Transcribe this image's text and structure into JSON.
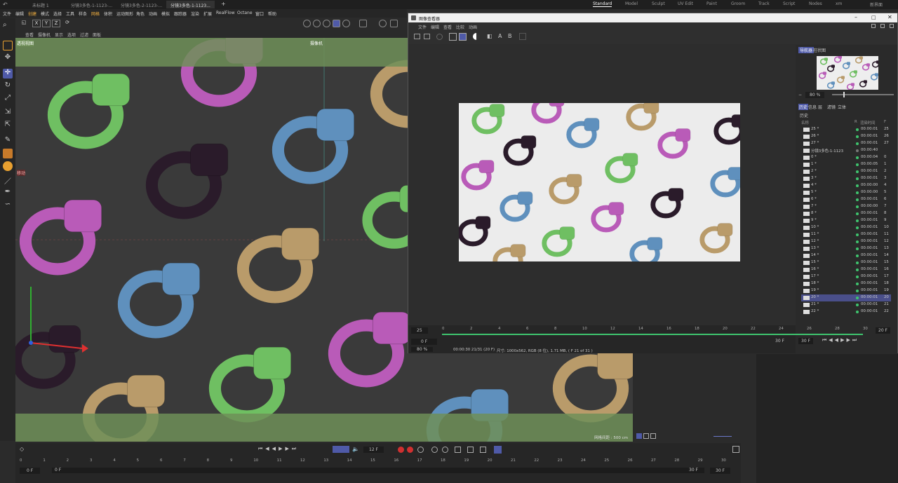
{
  "tabs": {
    "documents": [
      "未标题 1",
      "分镜3多色-1-1123-...",
      "分镜3多色-2-1123-...",
      "分镜3多色-1-1123..."
    ],
    "layouts": [
      "Standard",
      "Model",
      "Sculpt",
      "UV Edit",
      "Paint",
      "Groom",
      "Track",
      "Script",
      "Nodes",
      "xm",
      "新界面"
    ],
    "active_layout": "Standard"
  },
  "menu": [
    "文件",
    "编辑",
    "创建",
    "模式",
    "选择",
    "工具",
    "样条",
    "网格",
    "体积",
    "运动图形",
    "角色",
    "动画",
    "模拟",
    "跟踪器",
    "渲染",
    "扩展",
    "RealFlow",
    "Octane",
    "窗口",
    "帮助"
  ],
  "axes": [
    "X",
    "Y",
    "Z"
  ],
  "viewport": {
    "menu": [
      "查看",
      "摄像机",
      "显示",
      "选项",
      "过滤",
      "面板"
    ],
    "label": "透视视图",
    "camera_label": "摄像机",
    "move_label": "移动",
    "grid_label": "网格间距 : 500 cm"
  },
  "viewer": {
    "title": "图像查看器",
    "menu": [
      "文件",
      "编辑",
      "查看",
      "比较",
      "动画"
    ],
    "nav_tabs": [
      "导航器",
      "柱状图"
    ],
    "zoom": "80 %",
    "hist_tabs": [
      "历史",
      "信息",
      "层",
      "滤镜",
      "立体"
    ],
    "hist_header": "历史",
    "cols": {
      "name": "名称",
      "r": "R",
      "time": "渲染时间",
      "f": "F"
    },
    "rows": [
      {
        "label": "25 *",
        "time": "00:00:01",
        "f": "25"
      },
      {
        "label": "26 *",
        "time": "00:00:01",
        "f": "26"
      },
      {
        "label": "27 *",
        "time": "00:00:01",
        "f": "27"
      },
      {
        "label": "分镜3多色-1-1123",
        "time": "00:00:40",
        "f": ""
      },
      {
        "label": "0 *",
        "time": "00:00:04",
        "f": "0"
      },
      {
        "label": "1 *",
        "time": "00:00:05",
        "f": "1"
      },
      {
        "label": "2 *",
        "time": "00:00:01",
        "f": "2"
      },
      {
        "label": "3 *",
        "time": "00:00:01",
        "f": "3"
      },
      {
        "label": "4 *",
        "time": "00:00:00",
        "f": "4"
      },
      {
        "label": "5 *",
        "time": "00:00:00",
        "f": "5"
      },
      {
        "label": "6 *",
        "time": "00:00:01",
        "f": "6"
      },
      {
        "label": "7 *",
        "time": "00:00:00",
        "f": "7"
      },
      {
        "label": "8 *",
        "time": "00:00:01",
        "f": "8"
      },
      {
        "label": "9 *",
        "time": "00:00:01",
        "f": "9"
      },
      {
        "label": "10 *",
        "time": "00:00:01",
        "f": "10"
      },
      {
        "label": "11 *",
        "time": "00:00:01",
        "f": "11"
      },
      {
        "label": "12 *",
        "time": "00:00:01",
        "f": "12"
      },
      {
        "label": "13 *",
        "time": "00:00:01",
        "f": "13"
      },
      {
        "label": "14 *",
        "time": "00:00:01",
        "f": "14"
      },
      {
        "label": "15 *",
        "time": "00:00:01",
        "f": "15"
      },
      {
        "label": "16 *",
        "time": "00:00:01",
        "f": "16"
      },
      {
        "label": "17 *",
        "time": "00:00:01",
        "f": "17"
      },
      {
        "label": "18 *",
        "time": "00:00:01",
        "f": "18"
      },
      {
        "label": "19 *",
        "time": "00:00:01",
        "f": "19"
      },
      {
        "label": "20 *",
        "time": "00:00:01",
        "f": "20"
      },
      {
        "label": "21 *",
        "time": "00:00:01",
        "f": "21"
      },
      {
        "label": "22 *",
        "time": "00:00:01",
        "f": "22"
      }
    ],
    "selected_row": 24,
    "timeline": {
      "start": "25",
      "end_field": "20 F",
      "frame": "0 F",
      "end": "30 F",
      "fps": "30 F",
      "ticks": [
        "0",
        "2",
        "4",
        "6",
        "8",
        "10",
        "12",
        "14",
        "16",
        "18",
        "20",
        "22",
        "24",
        "26",
        "28",
        "30"
      ]
    },
    "status": {
      "zoom": "80 %",
      "time": "00:00:30 21/31 (20 F)",
      "info": "尺寸: 1000x562, RGB (8 位), 1.71 MB, ( F 21 of 31 )"
    }
  },
  "timeline": {
    "frame": "12 F",
    "start": "0 F",
    "start2": "0 F",
    "end": "30 F",
    "end2": "30 F",
    "ticks": [
      "0",
      "1",
      "2",
      "3",
      "4",
      "5",
      "6",
      "7",
      "8",
      "9",
      "10",
      "11",
      "12",
      "13",
      "14",
      "15",
      "16",
      "17",
      "18",
      "19",
      "20",
      "21",
      "22",
      "23",
      "24",
      "25",
      "26",
      "27",
      "28",
      "29",
      "30"
    ]
  },
  "colors": {
    "green": "#6fbf62",
    "pink": "#b95bb8",
    "blue": "#5f90bd",
    "tan": "#b99b6a",
    "black": "#2a1b2a",
    "safe": "#6f8f58",
    "accent": "#4f5aa8"
  }
}
